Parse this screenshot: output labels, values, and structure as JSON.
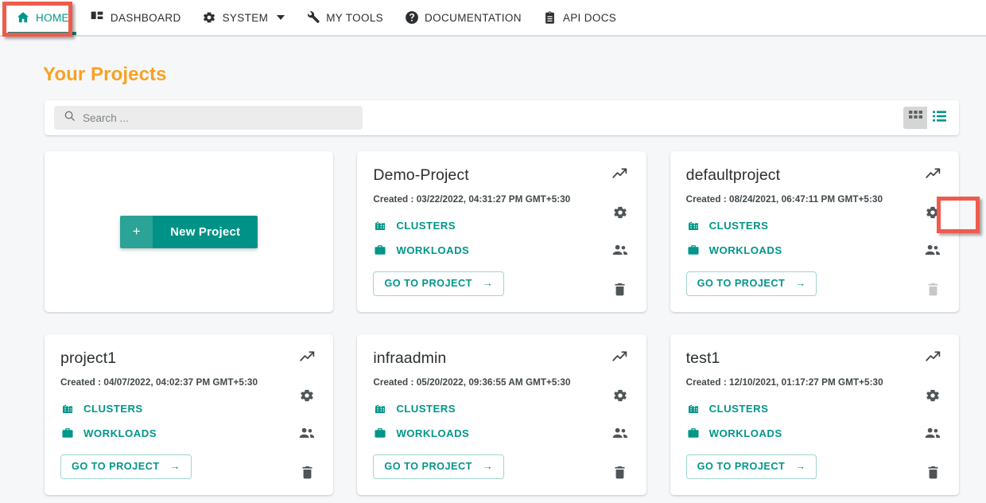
{
  "nav": {
    "items": [
      {
        "label": "HOME",
        "icon": "home-icon",
        "active": true
      },
      {
        "label": "DASHBOARD",
        "icon": "dashboard-icon",
        "active": false
      },
      {
        "label": "SYSTEM",
        "icon": "gear-icon",
        "active": false,
        "caret": true
      },
      {
        "label": "MY TOOLS",
        "icon": "wrench-icon",
        "active": false
      },
      {
        "label": "DOCUMENTATION",
        "icon": "help-circle-icon",
        "active": false
      },
      {
        "label": "API DOCS",
        "icon": "clipboard-icon",
        "active": false
      }
    ]
  },
  "page": {
    "title": "Your Projects",
    "title_color": "#f7a223",
    "accent_color": "#009688"
  },
  "search": {
    "placeholder": "Search ...",
    "value": "",
    "icon": "search-icon"
  },
  "view_toggle": {
    "grid_icon": "grid-view-icon",
    "list_icon": "list-view-icon",
    "selected": "grid"
  },
  "new_project": {
    "plus": "+",
    "label": "New Project"
  },
  "card_labels": {
    "clusters": "CLUSTERS",
    "workloads": "WORKLOADS",
    "goto": "GO TO PROJECT",
    "arrow": "→",
    "created_prefix": "Created : "
  },
  "projects": [
    {
      "name": "Demo-Project",
      "created": "Created : 03/22/2022, 04:31:27 PM GMT+5:30",
      "trash_disabled": false
    },
    {
      "name": "defaultproject",
      "created": "Created : 08/24/2021, 06:47:11 PM GMT+5:30",
      "trash_disabled": true
    },
    {
      "name": "project1",
      "created": "Created : 04/07/2022, 04:02:37 PM GMT+5:30",
      "trash_disabled": false
    },
    {
      "name": "infraadmin",
      "created": "Created : 05/20/2022, 09:36:55 AM GMT+5:30",
      "trash_disabled": false
    },
    {
      "name": "test1",
      "created": "Created : 12/10/2021, 01:17:27 PM GMT+5:30",
      "trash_disabled": false
    }
  ],
  "annotations": [
    {
      "target": "nav-item-home",
      "color": "#ef5b4c"
    },
    {
      "target": "defaultproject-settings-gear",
      "color": "#ef5b4c"
    }
  ]
}
